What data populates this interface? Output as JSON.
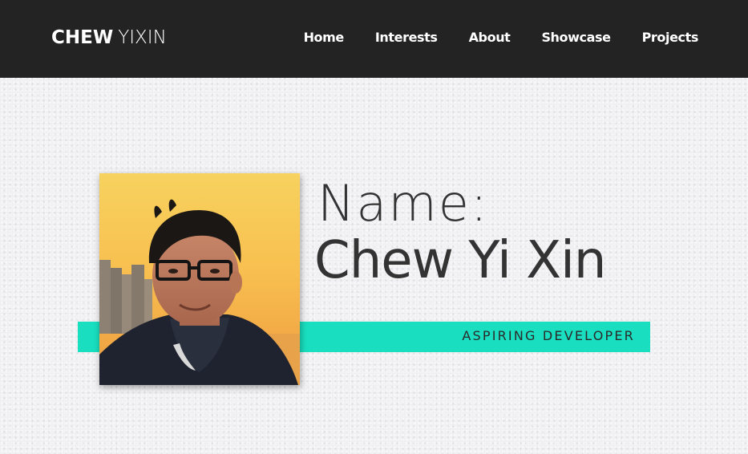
{
  "header": {
    "brand_first": "CHEW",
    "brand_second": "YIXIN",
    "nav": [
      {
        "label": "Home"
      },
      {
        "label": "Interests"
      },
      {
        "label": "About"
      },
      {
        "label": "Showcase"
      },
      {
        "label": "Projects"
      }
    ]
  },
  "hero": {
    "name_label": "Name:",
    "name_value": "Chew Yi Xin",
    "subtitle": "ASPIRING DEVELOPER",
    "photo_icon": "profile-photo"
  },
  "colors": {
    "nav_background": "#232323",
    "accent_stripe": "#19dfc0",
    "text_dark": "#333333",
    "page_background": "#eeeef1"
  }
}
